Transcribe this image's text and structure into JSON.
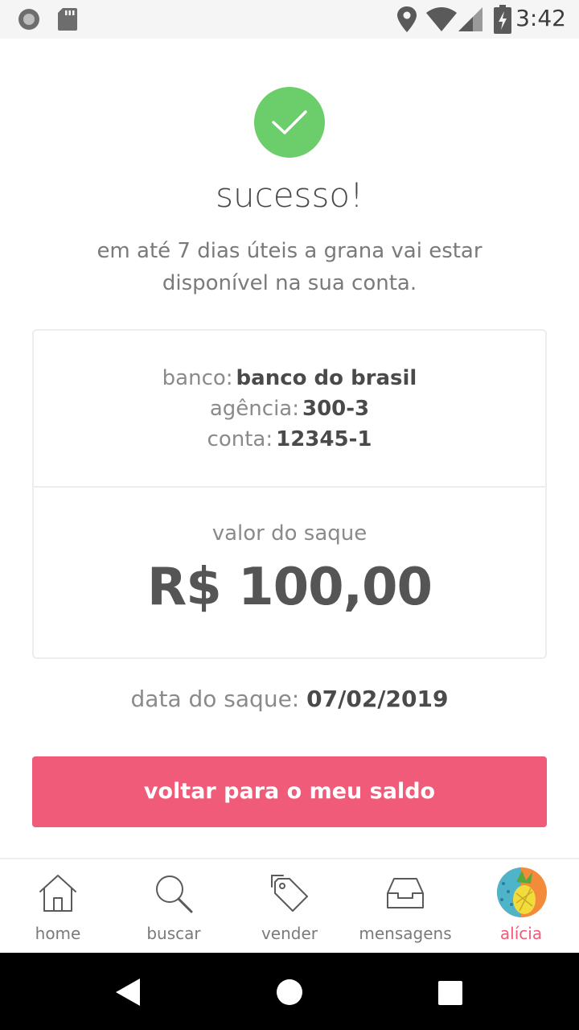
{
  "status_bar": {
    "time": "3:42"
  },
  "success": {
    "title": "sucesso!",
    "subtitle": "em até 7 dias úteis a grana vai estar disponível na sua conta."
  },
  "bank": {
    "bank_label": "banco:",
    "bank_value": "banco do brasil",
    "agency_label": "agência:",
    "agency_value": "300-3",
    "account_label": "conta:",
    "account_value": "12345-1"
  },
  "withdrawal": {
    "amount_label": "valor do saque",
    "amount_value": "R$ 100,00",
    "date_label": "data do saque:",
    "date_value": "07/02/2019"
  },
  "actions": {
    "back_button": "voltar para o meu saldo"
  },
  "bottom_nav": {
    "items": [
      {
        "label": "home",
        "icon": "home-icon"
      },
      {
        "label": "buscar",
        "icon": "search-icon"
      },
      {
        "label": "vender",
        "icon": "tag-icon"
      },
      {
        "label": "mensagens",
        "icon": "inbox-icon"
      },
      {
        "label": "alícia",
        "icon": "avatar",
        "active": true
      }
    ]
  },
  "colors": {
    "accent": "#ef5b78",
    "success": "#6cce6a"
  }
}
